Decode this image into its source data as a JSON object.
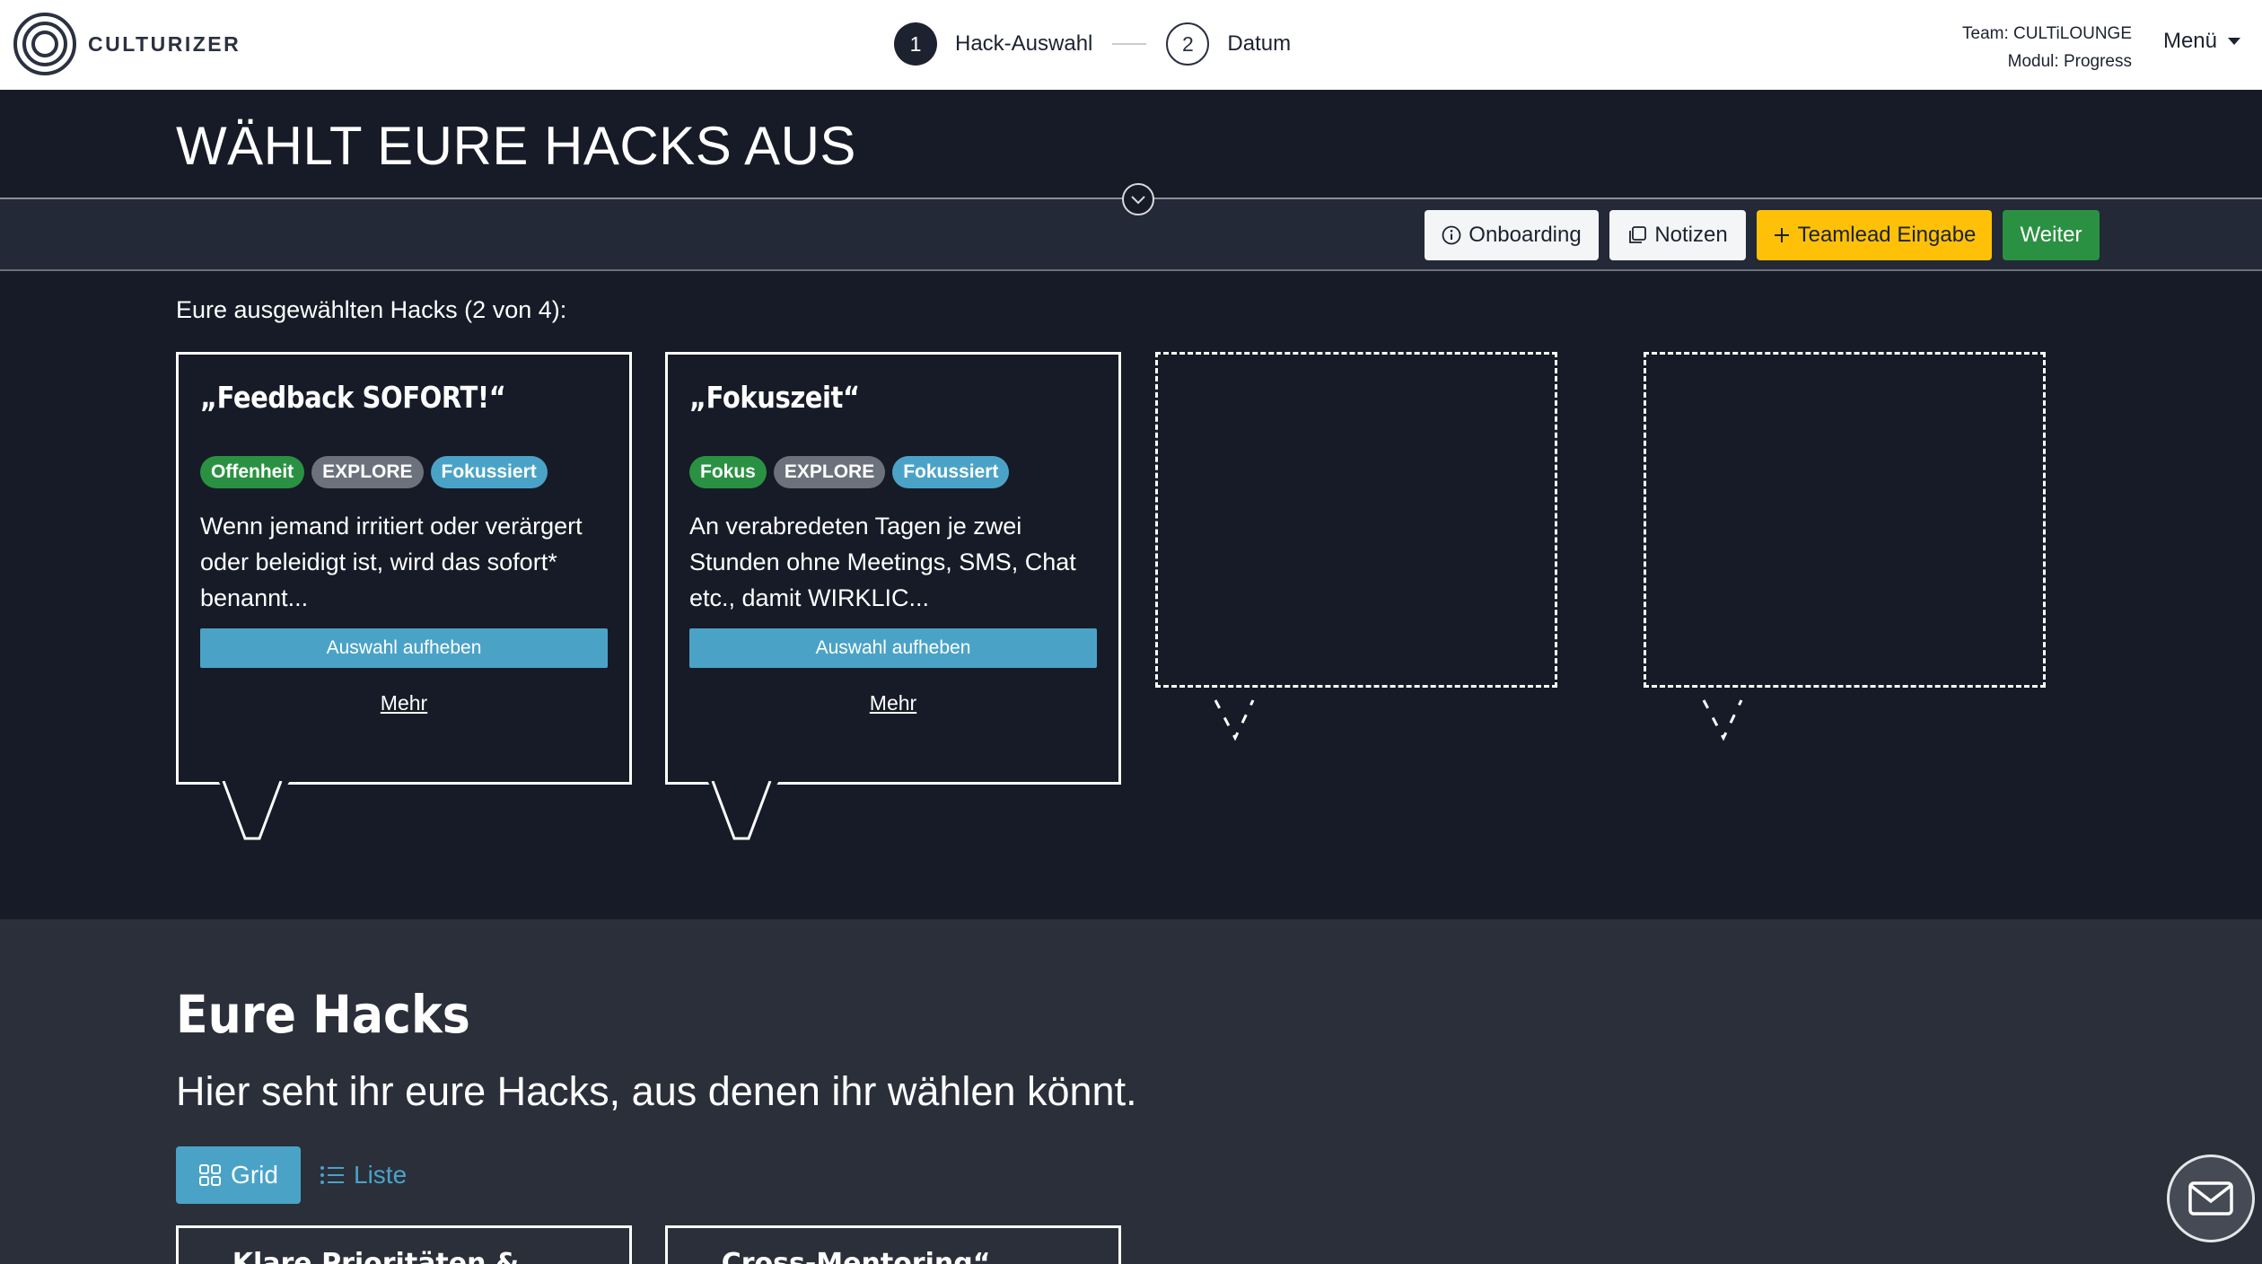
{
  "header": {
    "logo_text": "CULTURIZER",
    "steps": [
      {
        "number": "1",
        "label": "Hack-Auswahl"
      },
      {
        "number": "2",
        "label": "Datum"
      }
    ],
    "team": "Team: CULTiLOUNGE",
    "module": "Modul: Progress",
    "menu_label": "Menü"
  },
  "page": {
    "title": "WÄHLT EURE HACKS AUS"
  },
  "toolbar": {
    "onboarding_label": "Onboarding",
    "notes_label": "Notizen",
    "teamlead_label": "Teamlead Eingabe",
    "next_label": "Weiter"
  },
  "selection": {
    "label": "Eure ausgewählten Hacks (2 von 4):",
    "cards": [
      {
        "title": "„Feedback SOFORT!“",
        "tags": [
          {
            "text": "Offenheit",
            "color": "#2a9142"
          },
          {
            "text": "EXPLORE",
            "color": "#6c727c"
          },
          {
            "text": "Fokussiert",
            "color": "#4aa3c7"
          }
        ],
        "description": "Wenn jemand irritiert oder verärgert oder beleidigt ist, wird das sofort* benannt...",
        "deselect_label": "Auswahl aufheben",
        "more_label": "Mehr"
      },
      {
        "title": "„Fokuszeit“",
        "tags": [
          {
            "text": "Fokus",
            "color": "#2a9142"
          },
          {
            "text": "EXPLORE",
            "color": "#6c727c"
          },
          {
            "text": "Fokussiert",
            "color": "#4aa3c7"
          }
        ],
        "description": "An verabredeten Tagen je zwei Stunden ohne Meetings, SMS, Chat etc., damit WIRKLIC...",
        "deselect_label": "Auswahl aufheben",
        "more_label": "Mehr"
      }
    ]
  },
  "hacks": {
    "title": "Eure Hacks",
    "subtitle": "Hier seht ihr eure Hacks, aus denen ihr wählen könnt.",
    "view_grid_label": "Grid",
    "view_list_label": "Liste",
    "cards": [
      {
        "title": "„Klare Prioritäten & ..."
      },
      {
        "title": "„Cross-Mentoring“"
      }
    ]
  },
  "colors": {
    "dark_bg": "#161b27",
    "accent_blue": "#4aa3c7",
    "accent_green": "#2a9142",
    "accent_yellow": "#ffc107"
  }
}
